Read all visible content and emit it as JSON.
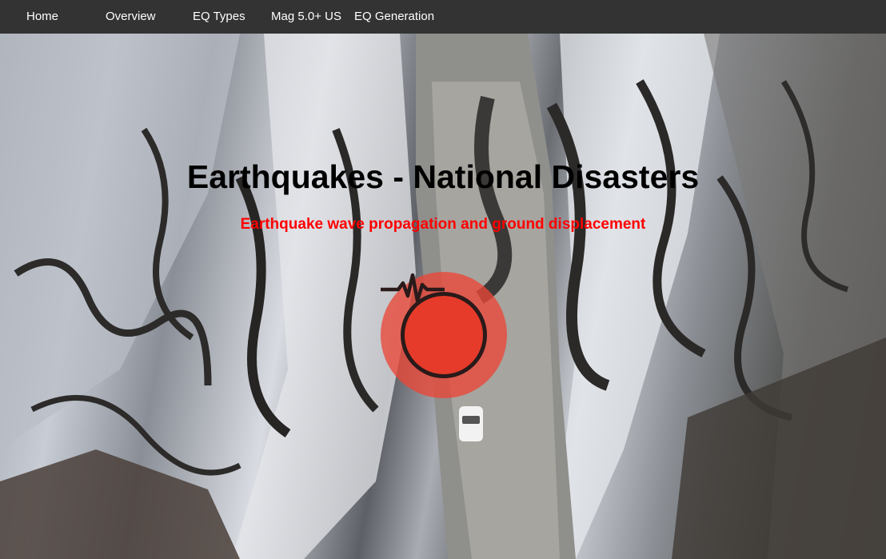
{
  "nav": {
    "items": [
      {
        "label": "Home"
      },
      {
        "label": "Overview"
      },
      {
        "label": "EQ Types"
      },
      {
        "label": "Mag 5.0+ US"
      },
      {
        "label": "EQ Generation"
      }
    ]
  },
  "hero": {
    "title": "Earthquakes - National Disasters",
    "subtitle": "Earthquake wave propagation and ground displacement",
    "logo_icon": "seismograph-icon"
  },
  "colors": {
    "navbar_bg": "#333333",
    "nav_text": "#ffffff",
    "title": "#000000",
    "subtitle": "#ff0000",
    "logo_red": "#e63b2a"
  }
}
